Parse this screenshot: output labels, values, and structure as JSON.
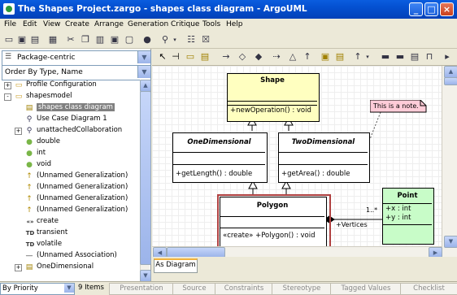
{
  "window": {
    "title": "The Shapes Project.zargo - shapes class diagram - ArgoUML"
  },
  "menu": [
    "File",
    "Edit",
    "View",
    "Create",
    "Arrange",
    "Generation",
    "Critique",
    "Tools",
    "Help"
  ],
  "explorer": {
    "perspective": "Package-centric",
    "ordering": "Order By Type, Name",
    "tree": [
      {
        "label": "Profile Configuration",
        "indent": 0,
        "icon": "folder-icon",
        "expander": "+"
      },
      {
        "label": "shapesmodel",
        "indent": 0,
        "icon": "folder-icon",
        "expander": "-"
      },
      {
        "label": "shapes class diagram",
        "indent": 1,
        "icon": "class-diagram-icon",
        "selected": true
      },
      {
        "label": "Use Case Diagram 1",
        "indent": 1,
        "icon": "usecase-diagram-icon"
      },
      {
        "label": "unattachedCollaboration",
        "indent": 1,
        "icon": "collaboration-icon",
        "expander": "+"
      },
      {
        "label": "double",
        "indent": 1,
        "icon": "datatype-icon"
      },
      {
        "label": "int",
        "indent": 1,
        "icon": "datatype-icon"
      },
      {
        "label": "void",
        "indent": 1,
        "icon": "datatype-icon"
      },
      {
        "label": "(Unnamed Generalization)",
        "indent": 1,
        "icon": "generalization-icon"
      },
      {
        "label": "(Unnamed Generalization)",
        "indent": 1,
        "icon": "generalization-icon"
      },
      {
        "label": "(Unnamed Generalization)",
        "indent": 1,
        "icon": "generalization-icon"
      },
      {
        "label": "(Unnamed Generalization)",
        "indent": 1,
        "icon": "generalization-icon"
      },
      {
        "label": "create",
        "indent": 1,
        "icon": "stereotype-icon"
      },
      {
        "label": "transient",
        "indent": 1,
        "icon": "tagdef-icon"
      },
      {
        "label": "volatile",
        "indent": 1,
        "icon": "tagdef-icon"
      },
      {
        "label": "(Unnamed Association)",
        "indent": 1,
        "icon": "association-icon"
      },
      {
        "label": "OneDimensional",
        "indent": 1,
        "icon": "class-icon",
        "expander": "+"
      }
    ]
  },
  "diagram": {
    "tab": "As Diagram",
    "classes": [
      {
        "id": "shape",
        "name": "Shape",
        "italic": false,
        "ops": [
          "+newOperation() : void"
        ]
      },
      {
        "id": "onedim",
        "name": "OneDimensional",
        "italic": true,
        "ops": [
          "+getLength() : double"
        ]
      },
      {
        "id": "twodim",
        "name": "TwoDimensional",
        "italic": true,
        "ops": [
          "+getArea() : double"
        ]
      },
      {
        "id": "polygon",
        "name": "Polygon",
        "italic": false,
        "ops": [
          "«create» +Polygon() : void"
        ]
      },
      {
        "id": "point",
        "name": "Point",
        "italic": false,
        "attrs": [
          "+x : int",
          "+y : int"
        ]
      }
    ],
    "note": "This is a note.",
    "assoc": {
      "role": "+Vertices",
      "multiplicity": "1..*"
    }
  },
  "status": {
    "priority": "By Priority",
    "items": "9 Items",
    "tabs": [
      "Presentation",
      "Source",
      "Constraints",
      "Stereotype",
      "Tagged Values",
      "Checklist"
    ]
  },
  "colors": {
    "class_fill": "#ffffc0",
    "point_fill": "#c8fcc8",
    "note_fill": "#ffccd8",
    "selection": "#b04040"
  }
}
